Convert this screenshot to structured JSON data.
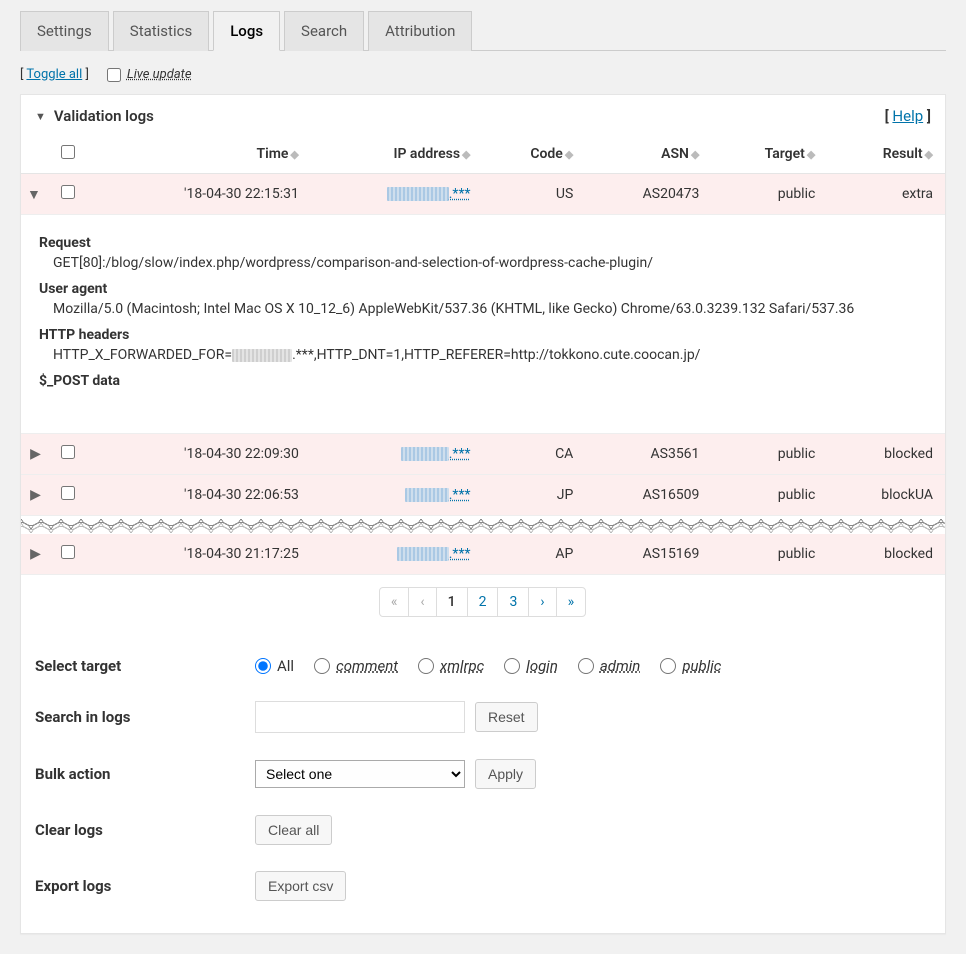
{
  "tabs": [
    "Settings",
    "Statistics",
    "Logs",
    "Search",
    "Attribution"
  ],
  "active_tab_index": 2,
  "toggle_all_label": "Toggle all",
  "live_update_label": "Live update",
  "panel_title": "Validation logs",
  "help_label": "Help",
  "columns": {
    "time": "Time",
    "ip": "IP address",
    "code": "Code",
    "asn": "ASN",
    "target": "Target",
    "result": "Result"
  },
  "rows": [
    {
      "expanded": true,
      "time": "'18-04-30 22:15:31",
      "ip_suffix": ".***",
      "code": "US",
      "asn": "AS20473",
      "target": "public",
      "result": "extra"
    },
    {
      "expanded": false,
      "time": "'18-04-30 22:09:30",
      "ip_suffix": ".***",
      "code": "CA",
      "asn": "AS3561",
      "target": "public",
      "result": "blocked"
    },
    {
      "expanded": false,
      "time": "'18-04-30 22:06:53",
      "ip_suffix": ".***",
      "code": "JP",
      "asn": "AS16509",
      "target": "public",
      "result": "blockUA"
    },
    {
      "expanded": false,
      "time": "'18-04-30 21:17:25",
      "ip_suffix": ".***",
      "code": "AP",
      "asn": "AS15169",
      "target": "public",
      "result": "blocked"
    }
  ],
  "detail": {
    "request_label": "Request",
    "request_value": "GET[80]:/blog/slow/index.php/wordpress/comparison-and-selection-of-wordpress-cache-plugin/",
    "ua_label": "User agent",
    "ua_value": "Mozilla/5.0 (Macintosh; Intel Mac OS X 10_12_6) AppleWebKit/537.36 (KHTML, like Gecko) Chrome/63.0.3239.132 Safari/537.36",
    "headers_label": "HTTP headers",
    "headers_prefix": "HTTP_X_FORWARDED_FOR=",
    "headers_suffix": ".***,HTTP_DNT=1,HTTP_REFERER=http://tokkono.cute.coocan.jp/",
    "post_label": "$_POST data"
  },
  "pagination": {
    "first": "«",
    "prev": "‹",
    "next": "›",
    "last": "»",
    "pages": [
      "1",
      "2",
      "3"
    ],
    "active": 0
  },
  "form": {
    "select_target_label": "Select target",
    "targets": [
      "All",
      "comment",
      "xmlrpc",
      "login",
      "admin",
      "public"
    ],
    "target_selected": 0,
    "search_label": "Search in logs",
    "reset_label": "Reset",
    "bulk_label": "Bulk action",
    "bulk_selected": "Select one",
    "apply_label": "Apply",
    "clear_label": "Clear logs",
    "clear_btn": "Clear all",
    "export_label": "Export logs",
    "export_btn": "Export csv"
  }
}
